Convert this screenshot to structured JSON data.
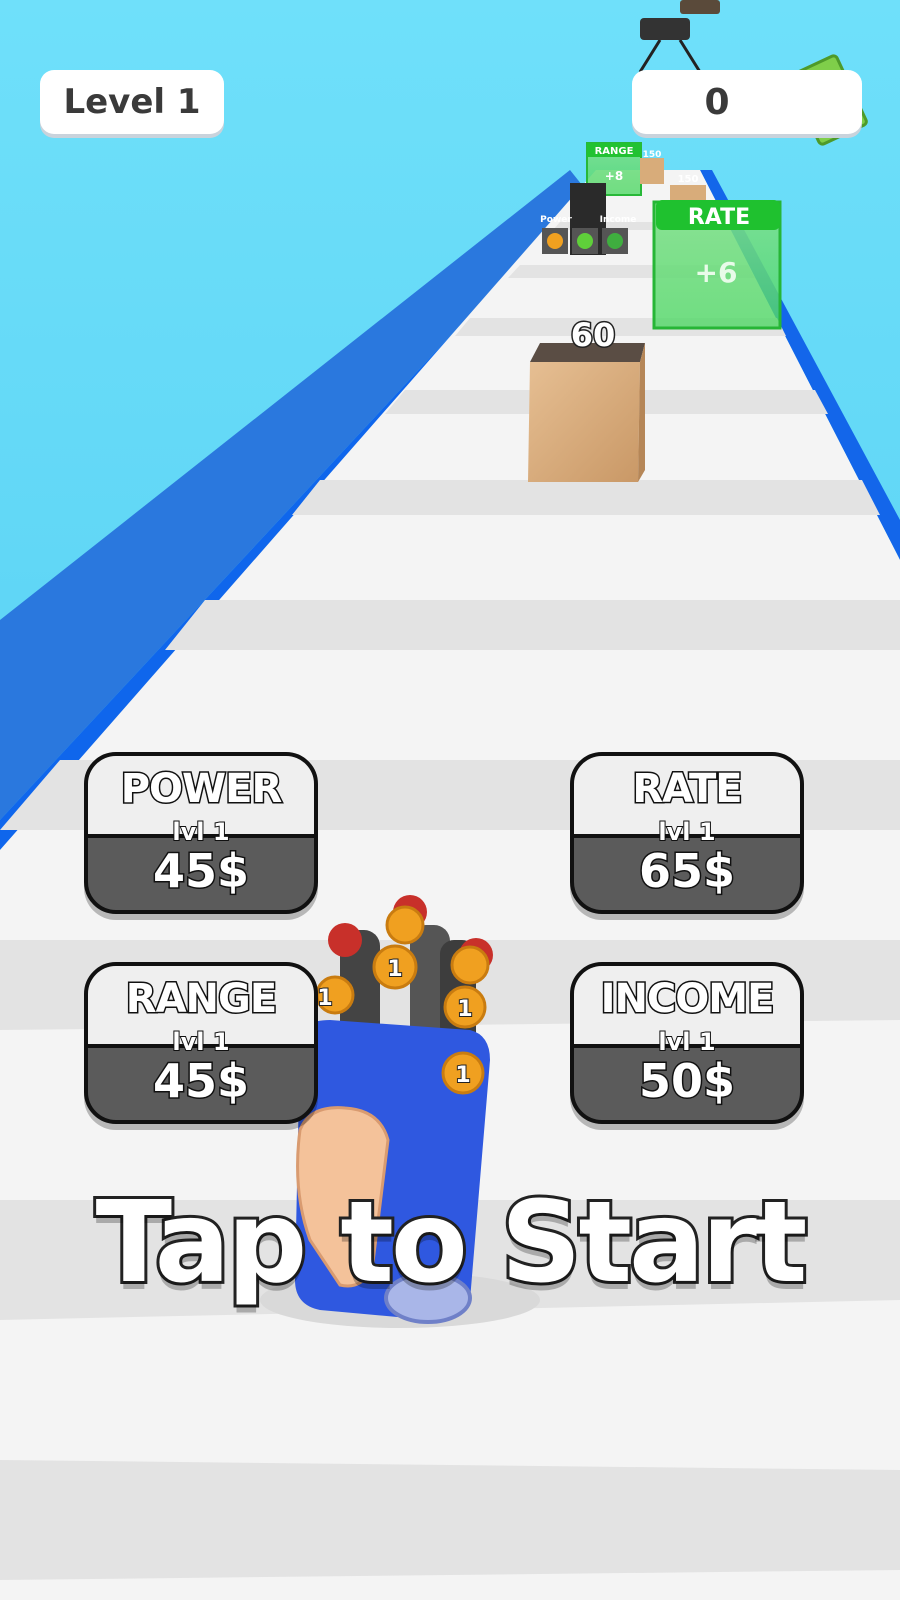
{
  "hud": {
    "level_label": "Level 1",
    "money": "0"
  },
  "world": {
    "block_hp": "60",
    "gate_near": {
      "label": "RATE",
      "bonus": "+6"
    },
    "gate_far": {
      "label": "RANGE",
      "bonus": "+8"
    },
    "far_blocks": [
      "150",
      "150"
    ],
    "far_stand_labels": [
      "Power",
      "Income"
    ],
    "gun_barrel_numbers": [
      "1",
      "1",
      "1",
      "1"
    ]
  },
  "upgrades": [
    {
      "name": "POWER",
      "level": "lvl 1",
      "cost": "45$"
    },
    {
      "name": "RATE",
      "level": "lvl 1",
      "cost": "65$"
    },
    {
      "name": "RANGE",
      "level": "lvl 1",
      "cost": "45$"
    },
    {
      "name": "INCOME",
      "level": "lvl 1",
      "cost": "50$"
    }
  ],
  "prompt": "Tap to Start",
  "colors": {
    "sky": "#5fd3f3",
    "rail": "#1a6fe8",
    "road": "#f2f2f2",
    "gate_green": "#2fcf3d",
    "upgrade_dark": "#5b5b5b"
  }
}
